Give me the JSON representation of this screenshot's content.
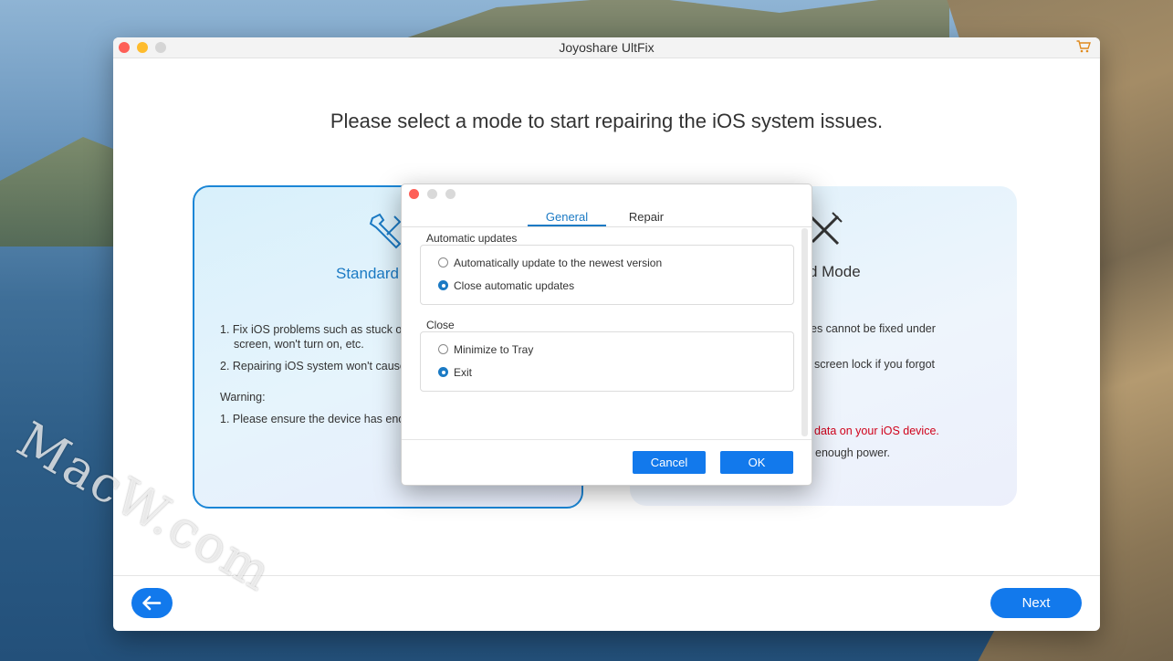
{
  "window": {
    "title": "Joyoshare UltFix"
  },
  "main": {
    "headline": "Please select a mode to start repairing the iOS system issues."
  },
  "standard_card": {
    "title": "Standard",
    "line1": "1. Fix iOS problems such as stuck on",
    "line1b": "screen, won't turn on, etc.",
    "line2": "2. Repairing iOS system won't cause a",
    "warning_label": "Warning:",
    "warning1": "1. Please ensure the device has enou"
  },
  "advanced_card": {
    "title": "ced Mode",
    "line1": "es cannot be fixed under",
    "line2": "screen lock if you forgot",
    "warning_red": "data on your iOS device.",
    "warning2": "enough power."
  },
  "footer": {
    "next_label": "Next"
  },
  "dialog": {
    "tabs": [
      "General",
      "Repair"
    ],
    "updates_group": "Automatic updates",
    "updates_options": [
      "Automatically update to the newest version",
      "Close automatic updates"
    ],
    "updates_selected": 1,
    "close_group": "Close",
    "close_options": [
      "Minimize to Tray",
      "Exit"
    ],
    "close_selected": 1,
    "cancel_label": "Cancel",
    "ok_label": "OK"
  },
  "watermark": "MacW.com",
  "colors": {
    "accent": "#1279ec",
    "card_border": "#1b86d6",
    "warning_red": "#d0021b"
  }
}
